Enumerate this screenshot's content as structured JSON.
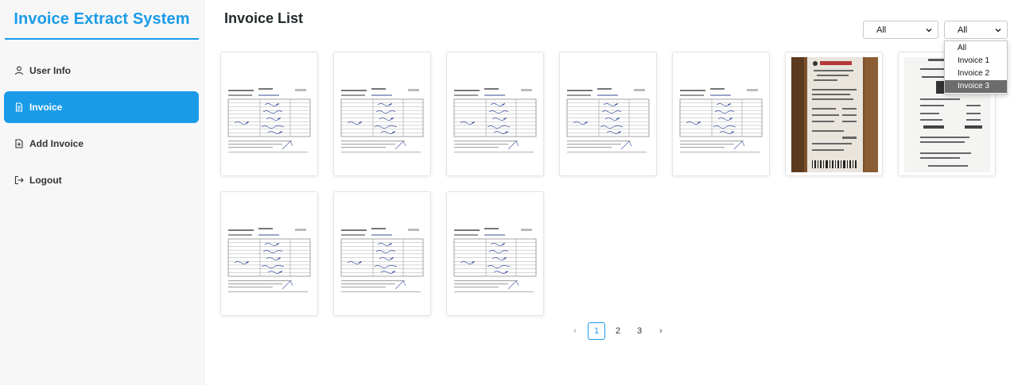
{
  "app": {
    "title": "Invoice Extract System"
  },
  "sidebar": {
    "items": [
      {
        "label": "User Info",
        "icon": "user-icon",
        "active": false
      },
      {
        "label": "Invoice",
        "icon": "invoice-icon",
        "active": true
      },
      {
        "label": "Add Invoice",
        "icon": "add-file-icon",
        "active": false
      },
      {
        "label": "Logout",
        "icon": "logout-icon",
        "active": false
      }
    ]
  },
  "main": {
    "title": "Invoice List",
    "filters": {
      "first": {
        "value": "All"
      },
      "second": {
        "value": "All",
        "options": [
          "All",
          "Invoice 1",
          "Invoice 2",
          "Invoice 3"
        ],
        "highlighted": "Invoice 3"
      }
    },
    "invoices": [
      {
        "type": "form-document"
      },
      {
        "type": "form-document"
      },
      {
        "type": "form-document"
      },
      {
        "type": "form-document"
      },
      {
        "type": "form-document"
      },
      {
        "type": "receipt-photo"
      },
      {
        "type": "receipt-scan"
      },
      {
        "type": "form-document"
      },
      {
        "type": "form-document"
      },
      {
        "type": "form-document"
      }
    ]
  },
  "pagination": {
    "prev": "‹",
    "pages": [
      "1",
      "2",
      "3"
    ],
    "current": "1",
    "next": "›"
  },
  "colors": {
    "accent": "#1a9be8",
    "sidebar_bg": "#f7f7f8",
    "title": "#1f2a2a"
  }
}
